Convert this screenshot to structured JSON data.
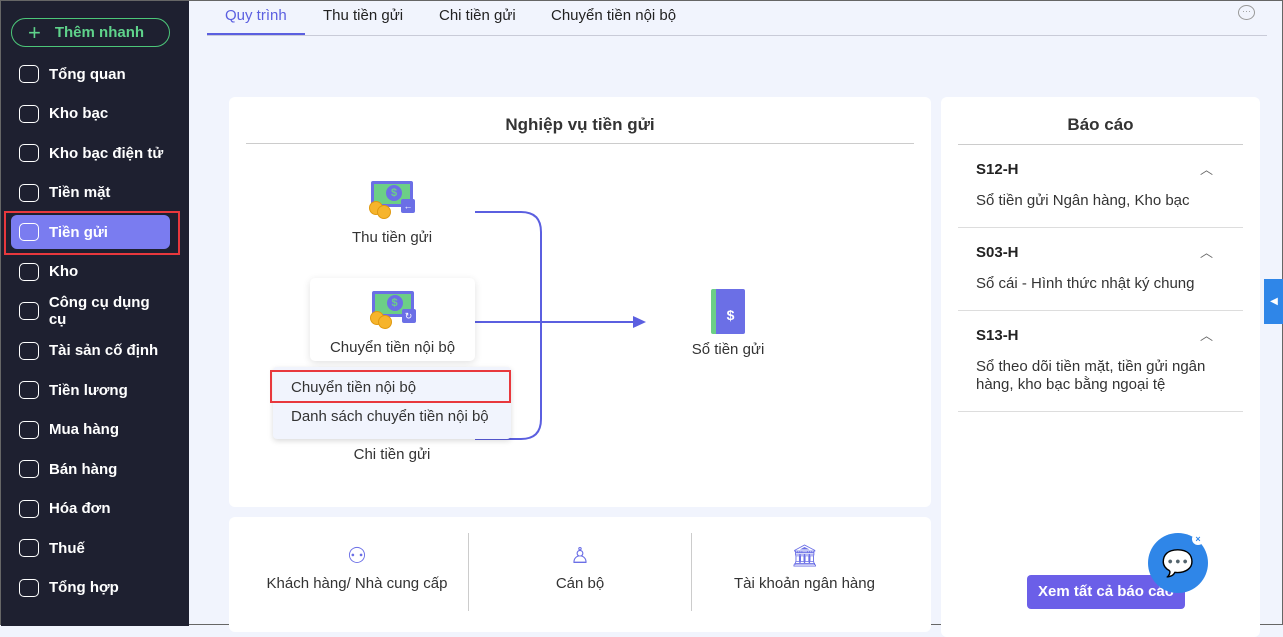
{
  "sidebar": {
    "quick_add": "Thêm nhanh",
    "items": [
      {
        "label": "Tổng quan",
        "icon": "pie-chart-icon"
      },
      {
        "label": "Kho bạc",
        "icon": "treasury-icon"
      },
      {
        "label": "Kho bạc điện tử",
        "icon": "e-treasury-icon"
      },
      {
        "label": "Tiền mặt",
        "icon": "cash-icon"
      },
      {
        "label": "Tiền gửi",
        "icon": "deposit-icon"
      },
      {
        "label": "Kho",
        "icon": "warehouse-icon"
      },
      {
        "label": "Công cụ dụng cụ",
        "icon": "tools-icon"
      },
      {
        "label": "Tài sản cố định",
        "icon": "truck-icon"
      },
      {
        "label": "Tiền lương",
        "icon": "salary-icon"
      },
      {
        "label": "Mua hàng",
        "icon": "cart-icon"
      },
      {
        "label": "Bán hàng",
        "icon": "store-icon"
      },
      {
        "label": "Hóa đơn",
        "icon": "invoice-icon"
      },
      {
        "label": "Thuế",
        "icon": "bank-icon"
      },
      {
        "label": "Tổng hợp",
        "icon": "summary-icon"
      }
    ]
  },
  "tabs": [
    "Quy trình",
    "Thu tiền gửi",
    "Chi tiền gửi",
    "Chuyển tiền nội bộ"
  ],
  "process": {
    "title": "Nghiệp vụ tiền gửi",
    "receive": "Thu tiền gửi",
    "transfer": "Chuyển tiền nội bộ",
    "pay": "Chi tiền gửi",
    "ledger": "Sổ tiền gửi",
    "menu": [
      "Chuyển tiền nội bộ",
      "Danh sách chuyển tiền nội bộ"
    ]
  },
  "shortcuts": [
    "Khách hàng/ Nhà cung cấp",
    "Cán bộ",
    "Tài khoản ngân hàng"
  ],
  "reports": {
    "title": "Báo cáo",
    "items": [
      {
        "code": "S12-H",
        "desc": "Sổ tiền gửi Ngân hàng, Kho bạc"
      },
      {
        "code": "S03-H",
        "desc": "Sổ cái - Hình thức nhật ký chung"
      },
      {
        "code": "S13-H",
        "desc": "Sổ theo dõi tiền mặt, tiền gửi ngân hàng, kho bạc bằng ngoại tệ"
      }
    ],
    "view_all": "Xem tất cả báo cáo"
  },
  "colors": {
    "accent": "#5b5fe0",
    "sidebar": "#1e2030",
    "highlight": "#e8383d"
  }
}
